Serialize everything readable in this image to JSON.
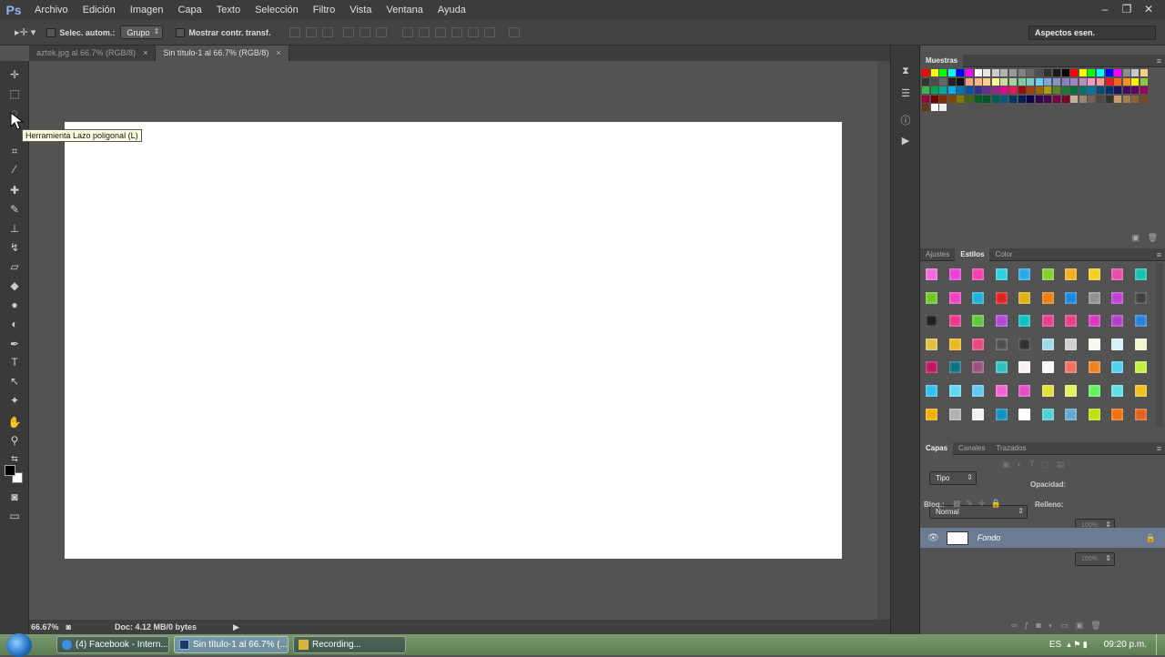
{
  "app": {
    "logo": "Ps"
  },
  "menu": [
    "Archivo",
    "Edición",
    "Imagen",
    "Capa",
    "Texto",
    "Selección",
    "Filtro",
    "Vista",
    "Ventana",
    "Ayuda"
  ],
  "window_controls": {
    "minimize": "–",
    "restore": "❐",
    "close": "✕"
  },
  "options_bar": {
    "auto_select_label": "Selec. autom.:",
    "group_value": "Grupo",
    "transform_label": "Mostrar contr. transf.",
    "workspace": "Aspectos esen."
  },
  "tabs": [
    {
      "label": "aztek.jpg al 66.7% (RGB/8)",
      "close": "×",
      "active": false
    },
    {
      "label": "Sin título-1 al 66.7% (RGB/8)",
      "close": "×",
      "active": true
    }
  ],
  "tooltip": "Herramienta Lazo poligonal (L)",
  "status": {
    "zoom": "66.67%",
    "doc": "Doc: 4.12 MB/0 bytes"
  },
  "swatches_panel": {
    "title": "Muestras"
  },
  "styles_panel": {
    "tabs": [
      "Ajustes",
      "Estilos",
      "Color"
    ],
    "active": "Estilos"
  },
  "layers_panel": {
    "tabs": [
      "Capas",
      "Canales",
      "Trazados"
    ],
    "filter": "Tipo",
    "blend_mode": "Normal",
    "opacity_label": "Opacidad:",
    "opacity_value": "100%",
    "lock_label": "Bloq.:",
    "fill_label": "Relleno:",
    "fill_value": "100%",
    "layer_name": "Fondo"
  },
  "taskbar": {
    "tasks": [
      {
        "label": "(4) Facebook - Intern...",
        "icon": "ie-icon"
      },
      {
        "label": "Sin título-1 al 66.7% (...",
        "icon": "photoshop-icon"
      },
      {
        "label": "Recording...",
        "icon": "recorder-icon"
      }
    ],
    "lang": "ES",
    "time": "09:20 p.m."
  },
  "colors": {
    "accent": "#6a7b92",
    "canvas": "#ffffff",
    "background": "#535353"
  }
}
